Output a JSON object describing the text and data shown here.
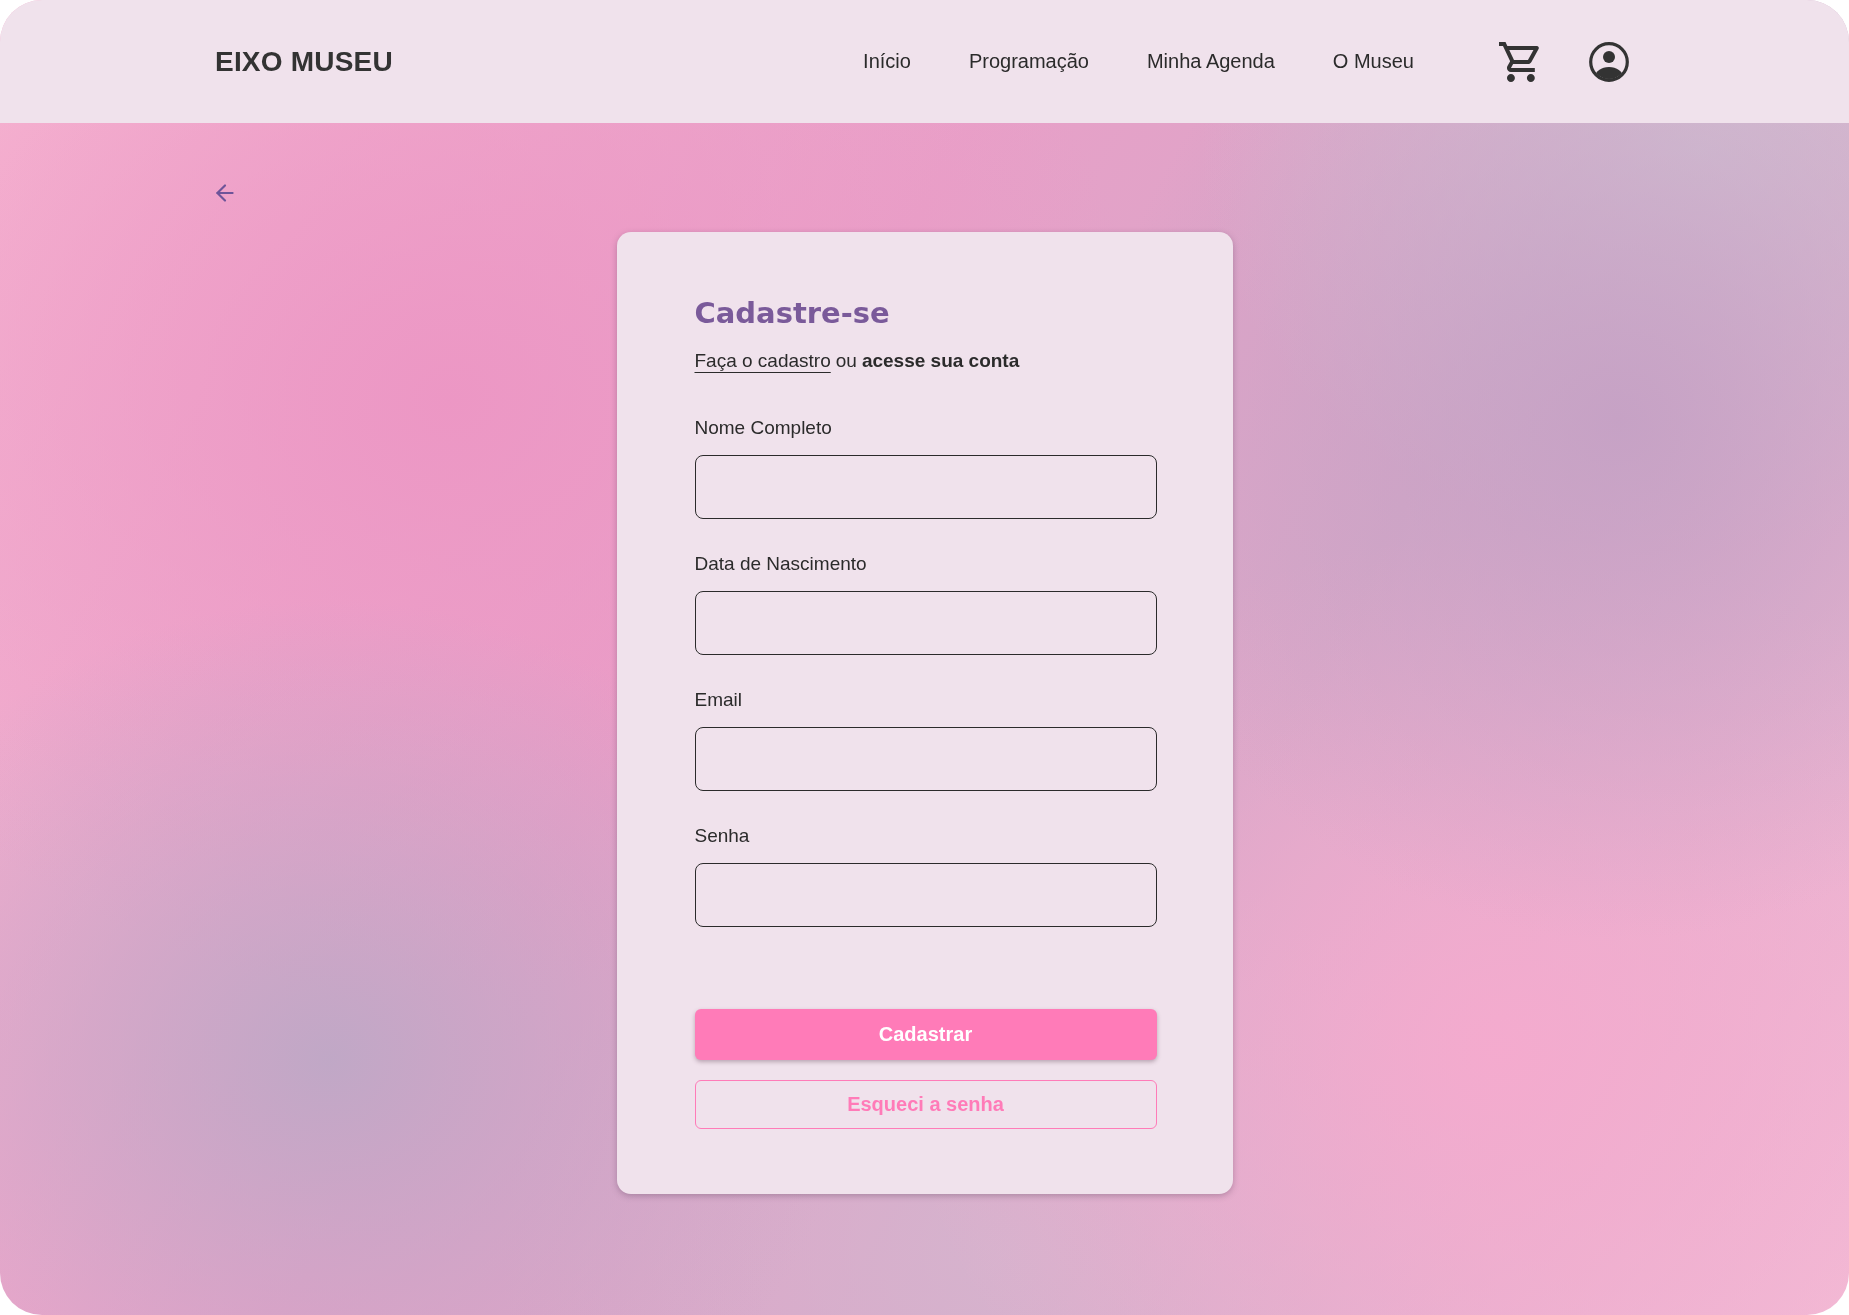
{
  "header": {
    "logo": "EIXO MUSEU",
    "nav": [
      "Início",
      "Programação",
      "Minha Agenda",
      "O Museu"
    ]
  },
  "form": {
    "title": "Cadastre-se",
    "subtitle": [
      {
        "kind": "underlined",
        "text": "Faça o cadastro"
      },
      {
        "kind": "plain",
        "text": "ou"
      },
      {
        "kind": "bold",
        "text": "acesse sua conta"
      }
    ],
    "fields": [
      {
        "label": "Nome Completo"
      },
      {
        "label": "Data de Nascimento"
      },
      {
        "label": "Email"
      },
      {
        "label": "Senha"
      }
    ],
    "buttons": [
      {
        "kind": "primary",
        "label": "Cadastrar"
      },
      {
        "kind": "outline",
        "label": "Esqueci a senha"
      }
    ]
  }
}
